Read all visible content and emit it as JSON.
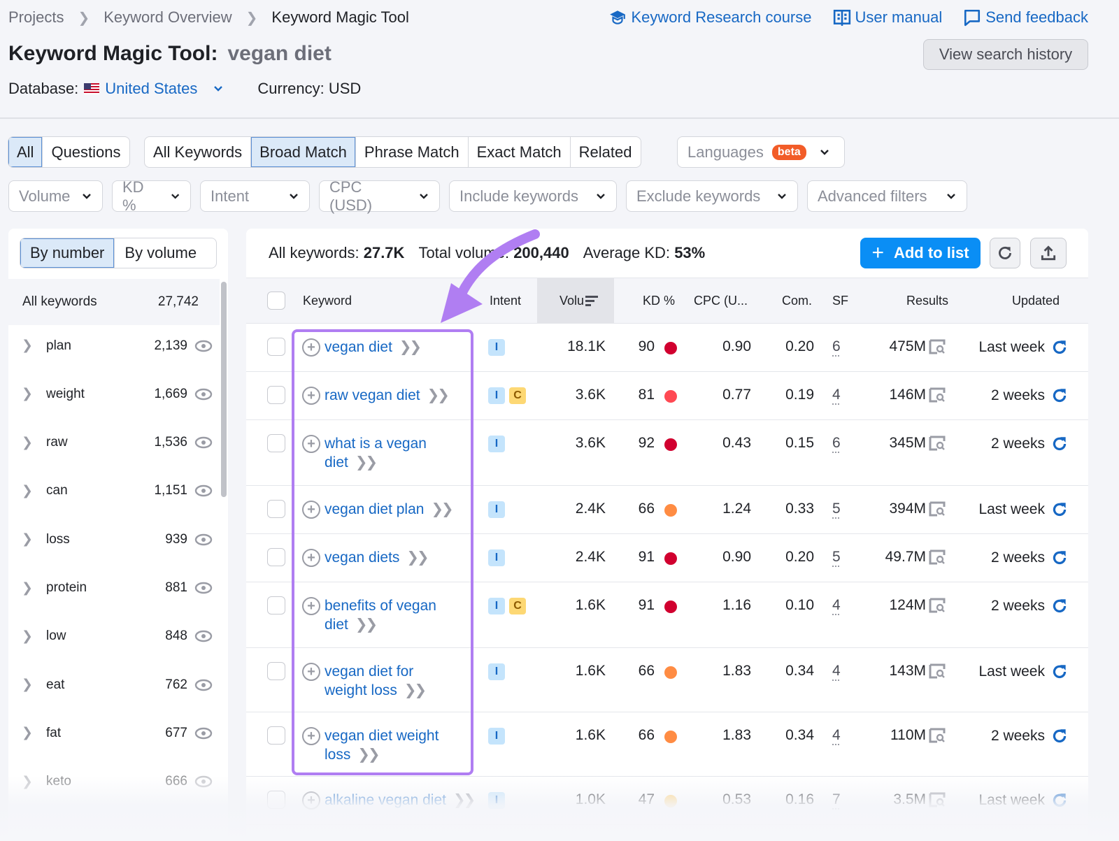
{
  "breadcrumb": [
    "Projects",
    "Keyword Overview",
    "Keyword Magic Tool"
  ],
  "top_links": [
    {
      "label": "Keyword Research course",
      "icon": "graduation-cap-icon"
    },
    {
      "label": "User manual",
      "icon": "book-icon"
    },
    {
      "label": "Send feedback",
      "icon": "speech-bubble-icon"
    }
  ],
  "title": {
    "prefix": "Keyword Magic Tool:",
    "query": "vegan diet"
  },
  "view_history_label": "View search history",
  "database": {
    "label": "Database:",
    "value": "United States",
    "currency": "Currency: USD"
  },
  "type_tabs": [
    {
      "label": "All",
      "active": true
    },
    {
      "label": "Questions",
      "active": false
    }
  ],
  "match_tabs": [
    {
      "label": "All Keywords",
      "active": false
    },
    {
      "label": "Broad Match",
      "active": true
    },
    {
      "label": "Phrase Match",
      "active": false
    },
    {
      "label": "Exact Match",
      "active": false
    },
    {
      "label": "Related",
      "active": false
    }
  ],
  "languages": {
    "label": "Languages",
    "badge": "beta"
  },
  "filters": [
    "Volume",
    "KD %",
    "Intent",
    "CPC (USD)",
    "Include keywords",
    "Exclude keywords",
    "Advanced filters"
  ],
  "groups": {
    "sort_tabs": [
      {
        "label": "By number",
        "active": true
      },
      {
        "label": "By volume",
        "active": false
      }
    ],
    "all_label": "All keywords",
    "all_count": "27,742",
    "items": [
      {
        "name": "plan",
        "count": "2,139"
      },
      {
        "name": "weight",
        "count": "1,669"
      },
      {
        "name": "raw",
        "count": "1,536"
      },
      {
        "name": "can",
        "count": "1,151"
      },
      {
        "name": "loss",
        "count": "939"
      },
      {
        "name": "protein",
        "count": "881"
      },
      {
        "name": "low",
        "count": "848"
      },
      {
        "name": "eat",
        "count": "762"
      },
      {
        "name": "fat",
        "count": "677"
      },
      {
        "name": "keto",
        "count": "666"
      }
    ]
  },
  "stats": {
    "all_keywords_label": "All keywords:",
    "all_keywords": "27.7K",
    "total_volume_label": "Total volume:",
    "total_volume": "200,440",
    "avg_kd_label": "Average KD:",
    "avg_kd": "53%"
  },
  "add_to_list_label": "Add to list",
  "columns": [
    "Keyword",
    "Intent",
    "Volu",
    "KD %",
    "CPC (U...",
    "Com.",
    "SF",
    "Results",
    "Updated"
  ],
  "kd_colors": {
    "very_hard": "#d1002f",
    "hard": "#ff4953",
    "difficult": "#ff8c43",
    "possible": "#ffcd6e"
  },
  "rows": [
    {
      "keyword": [
        "vegan diet"
      ],
      "intent": [
        "I"
      ],
      "volume": "18.1K",
      "kd": "90",
      "kd_color": "#d1002f",
      "cpc": "0.90",
      "com": "0.20",
      "sf": "6",
      "results": "475M",
      "updated": "Last week"
    },
    {
      "keyword": [
        "raw vegan diet"
      ],
      "intent": [
        "I",
        "C"
      ],
      "volume": "3.6K",
      "kd": "81",
      "kd_color": "#ff4953",
      "cpc": "0.77",
      "com": "0.19",
      "sf": "4",
      "results": "146M",
      "updated": "2 weeks"
    },
    {
      "keyword": [
        "what is a vegan",
        "diet"
      ],
      "intent": [
        "I"
      ],
      "volume": "3.6K",
      "kd": "92",
      "kd_color": "#d1002f",
      "cpc": "0.43",
      "com": "0.15",
      "sf": "6",
      "results": "345M",
      "updated": "2 weeks"
    },
    {
      "keyword": [
        "vegan diet plan"
      ],
      "intent": [
        "I"
      ],
      "volume": "2.4K",
      "kd": "66",
      "kd_color": "#ff8c43",
      "cpc": "1.24",
      "com": "0.33",
      "sf": "5",
      "results": "394M",
      "updated": "Last week"
    },
    {
      "keyword": [
        "vegan diets"
      ],
      "intent": [
        "I"
      ],
      "volume": "2.4K",
      "kd": "91",
      "kd_color": "#d1002f",
      "cpc": "0.90",
      "com": "0.20",
      "sf": "5",
      "results": "49.7M",
      "updated": "2 weeks"
    },
    {
      "keyword": [
        "benefits of vegan",
        "diet"
      ],
      "intent": [
        "I",
        "C"
      ],
      "volume": "1.6K",
      "kd": "91",
      "kd_color": "#d1002f",
      "cpc": "1.16",
      "com": "0.10",
      "sf": "4",
      "results": "124M",
      "updated": "2 weeks"
    },
    {
      "keyword": [
        "vegan diet for",
        "weight loss"
      ],
      "intent": [
        "I"
      ],
      "volume": "1.6K",
      "kd": "66",
      "kd_color": "#ff8c43",
      "cpc": "1.83",
      "com": "0.34",
      "sf": "4",
      "results": "143M",
      "updated": "Last week"
    },
    {
      "keyword": [
        "vegan diet weight",
        "loss"
      ],
      "intent": [
        "I"
      ],
      "volume": "1.6K",
      "kd": "66",
      "kd_color": "#ff8c43",
      "cpc": "1.83",
      "com": "0.34",
      "sf": "4",
      "results": "110M",
      "updated": "2 weeks"
    },
    {
      "keyword": [
        "alkaline vegan diet"
      ],
      "intent": [
        "I"
      ],
      "volume": "1.0K",
      "kd": "47",
      "kd_color": "#ffcd6e",
      "cpc": "0.53",
      "com": "0.16",
      "sf": "7",
      "results": "3.5M",
      "updated": "Last week"
    }
  ],
  "annotation": {
    "color": "#b07ef2",
    "target": "keyword column"
  }
}
